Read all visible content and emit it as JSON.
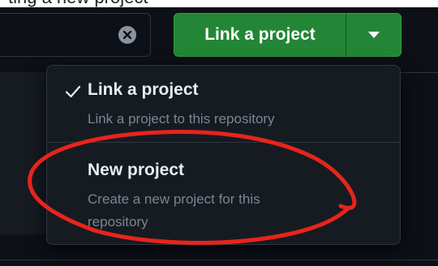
{
  "top_strip": {
    "text": "ting a new project"
  },
  "search": {
    "clear_icon": "x-circle-fill-icon"
  },
  "split_button": {
    "label": "Link a project",
    "dropdown_icon": "triangle-down-icon"
  },
  "menu": {
    "items": [
      {
        "title": "Link a project",
        "description": "Link a project to this repository",
        "selected": true,
        "icon": "check-icon"
      },
      {
        "title": "New project",
        "description": "Create a new project for this repository",
        "selected": false
      }
    ]
  },
  "colors": {
    "background": "#0d1117",
    "menu_background": "#161b22",
    "border": "#30363d",
    "primary_button": "#238636",
    "muted_text": "#7d8590",
    "annotation": "#e8241c"
  }
}
